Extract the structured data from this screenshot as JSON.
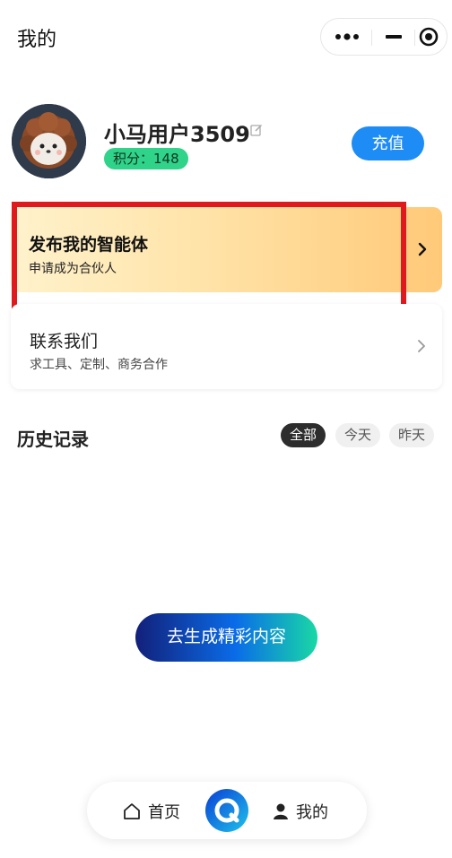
{
  "page": {
    "title": "我的"
  },
  "capsule": {
    "more_icon": "more-dots-icon",
    "minimize_icon": "minus-icon",
    "close_icon": "target-icon"
  },
  "profile": {
    "username": "小马用户3509",
    "points_label": "积分：",
    "points_value": "148",
    "recharge_label": "充值"
  },
  "publish": {
    "title": "发布我的智能体",
    "subtitle": "申请成为合伙人",
    "highlight_color": "#e0191f"
  },
  "contact": {
    "title": "联系我们",
    "subtitle": "求工具、定制、商务合作"
  },
  "history": {
    "title": "历史记录",
    "filters": [
      {
        "label": "全部",
        "active": true
      },
      {
        "label": "今天",
        "active": false
      },
      {
        "label": "昨天",
        "active": false
      }
    ]
  },
  "generate": {
    "label": "去生成精彩内容"
  },
  "nav": {
    "home_label": "首页",
    "mine_label": "我的",
    "home_icon": "home-icon",
    "mine_icon": "person-icon"
  },
  "colors": {
    "accent_blue": "#1e8cf5",
    "points_green": "#2fd38a"
  }
}
